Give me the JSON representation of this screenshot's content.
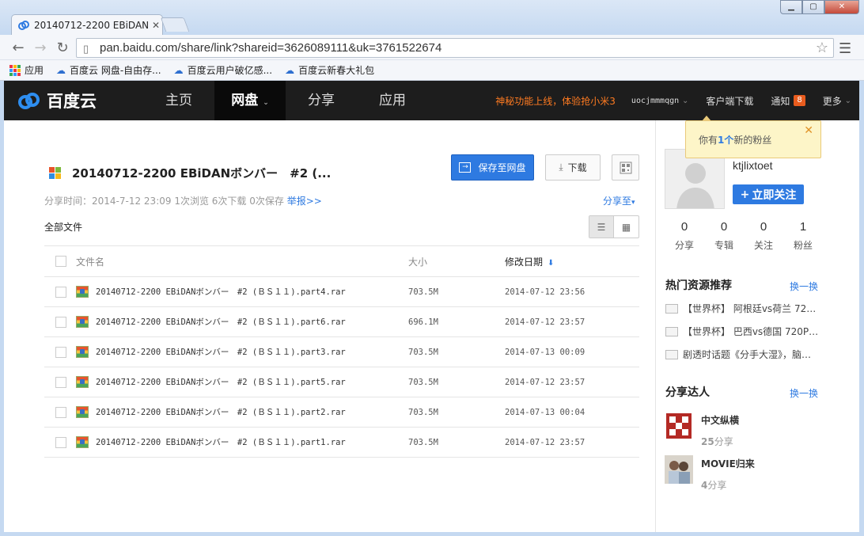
{
  "browser": {
    "tab_title": "20140712-2200 EBiDAN",
    "url": "pan.baidu.com/share/link?shareid=3626089111&uk=3761522674",
    "bookmarks": [
      "应用",
      "百度云 网盘-自由存...",
      "百度云用户破亿感...",
      "百度云新春大礼包"
    ],
    "window_controls": [
      "minimize",
      "maximize",
      "close"
    ]
  },
  "nav": {
    "brand": "百度云",
    "items": [
      "主页",
      "网盘",
      "分享",
      "应用"
    ],
    "active": "网盘",
    "promo": "神秘功能上线，体验抢小米3",
    "username": "uocjmmmqgn",
    "client_download": "客户端下载",
    "notify": "通知",
    "notify_count": "8",
    "more": "更多"
  },
  "share": {
    "title": "20140712-2200 EBiDANボンバー　#2 (...",
    "save_label": "保存至网盘",
    "download_label": "下载",
    "meta_prefix": "分享时间：2014-7-12 23:09 1次浏览 6次下载 0次保存",
    "report": "举报>>",
    "share_to": "分享至",
    "all_files": "全部文件",
    "columns": {
      "name": "文件名",
      "size": "大小",
      "date": "修改日期"
    },
    "files": [
      {
        "name": "20140712-2200 EBiDANボンバー　#2 (ＢＳ１１).part4.rar",
        "size": "703.5M",
        "date": "2014-07-12 23:56"
      },
      {
        "name": "20140712-2200 EBiDANボンバー　#2 (ＢＳ１１).part6.rar",
        "size": "696.1M",
        "date": "2014-07-12 23:57"
      },
      {
        "name": "20140712-2200 EBiDANボンバー　#2 (ＢＳ１１).part3.rar",
        "size": "703.5M",
        "date": "2014-07-13 00:09"
      },
      {
        "name": "20140712-2200 EBiDANボンバー　#2 (ＢＳ１１).part5.rar",
        "size": "703.5M",
        "date": "2014-07-12 23:57"
      },
      {
        "name": "20140712-2200 EBiDANボンバー　#2 (ＢＳ１１).part2.rar",
        "size": "703.5M",
        "date": "2014-07-13 00:04"
      },
      {
        "name": "20140712-2200 EBiDANボンバー　#2 (ＢＳ１１).part1.rar",
        "size": "703.5M",
        "date": "2014-07-12 23:57"
      }
    ]
  },
  "sidebar": {
    "tip_prefix": "你有",
    "tip_count": "1个",
    "tip_suffix": "新的粉丝",
    "username": "ktjlixtoet",
    "follow_label": "立即关注",
    "stats": [
      {
        "value": "0",
        "label": "分享"
      },
      {
        "value": "0",
        "label": "专辑"
      },
      {
        "value": "0",
        "label": "关注"
      },
      {
        "value": "1",
        "label": "粉丝"
      }
    ],
    "hot_title": "热门资源推荐",
    "change_label": "换一换",
    "hot_items": [
      "【世界杯】 阿根廷vs荷兰 72…",
      "【世界杯】 巴西vs德国 720P…",
      "剧透时话题《分手大湿》，脑…"
    ],
    "experts_title": "分享达人",
    "experts": [
      {
        "name": "中文纵横",
        "count": "25",
        "unit": "分享"
      },
      {
        "name": "MOVIE归来",
        "count": "4",
        "unit": "分享"
      }
    ]
  }
}
